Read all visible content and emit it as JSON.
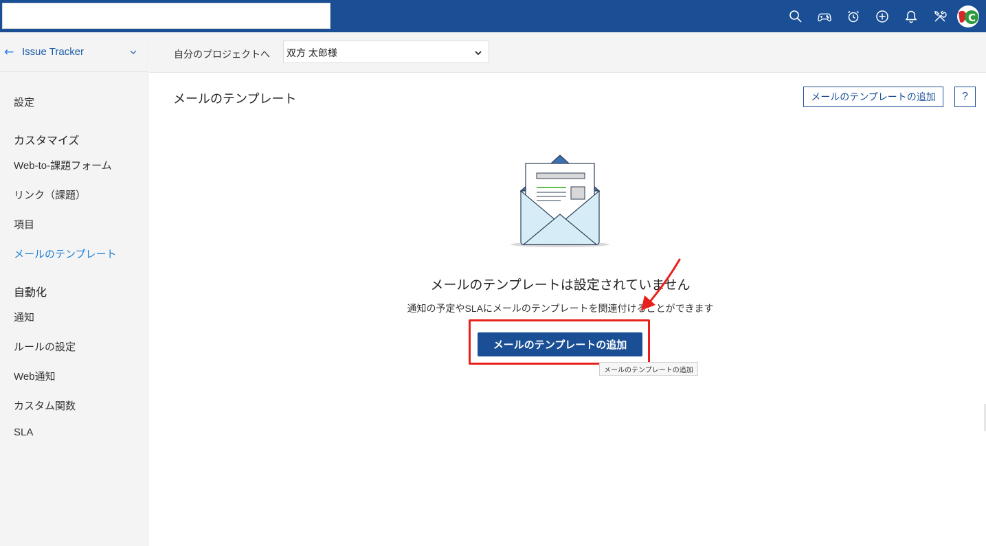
{
  "topbar": {
    "search_value": "",
    "icons": [
      "search-icon",
      "gamepad-icon",
      "alarm-icon",
      "plus-circle-icon",
      "bell-icon",
      "tools-icon",
      "avatar"
    ]
  },
  "sidebar": {
    "title": "Issue Tracker",
    "items": [
      {
        "label": "設定",
        "type": "item"
      },
      {
        "label": "カスタマイズ",
        "type": "group"
      },
      {
        "label": "Web-to-課題フォーム",
        "type": "item"
      },
      {
        "label": "リンク（課題）",
        "type": "item"
      },
      {
        "label": "項目",
        "type": "item"
      },
      {
        "label": "メールのテンプレート",
        "type": "item",
        "active": true
      },
      {
        "label": "自動化",
        "type": "group"
      },
      {
        "label": "通知",
        "type": "item"
      },
      {
        "label": "ルールの設定",
        "type": "item"
      },
      {
        "label": "Web通知",
        "type": "item"
      },
      {
        "label": "カスタム関数",
        "type": "item"
      },
      {
        "label": "SLA",
        "type": "item"
      }
    ]
  },
  "subheader": {
    "label": "自分のプロジェクトへ",
    "project_value": "双方 太郎様"
  },
  "main": {
    "title": "メールのテンプレート",
    "add_button_label": "メールのテンプレートの追加",
    "help_label": "?",
    "empty_title": "メールのテンプレートは設定されていません",
    "empty_desc": "通知の予定やSLAにメールのテンプレートを関連付けることができます",
    "primary_button_label": "メールのテンプレートの追加",
    "tooltip": "メールのテンプレートの追加"
  },
  "colors": {
    "brand": "#1a4f96",
    "active_link": "#1a7fd6",
    "highlight": "#e8201b"
  }
}
